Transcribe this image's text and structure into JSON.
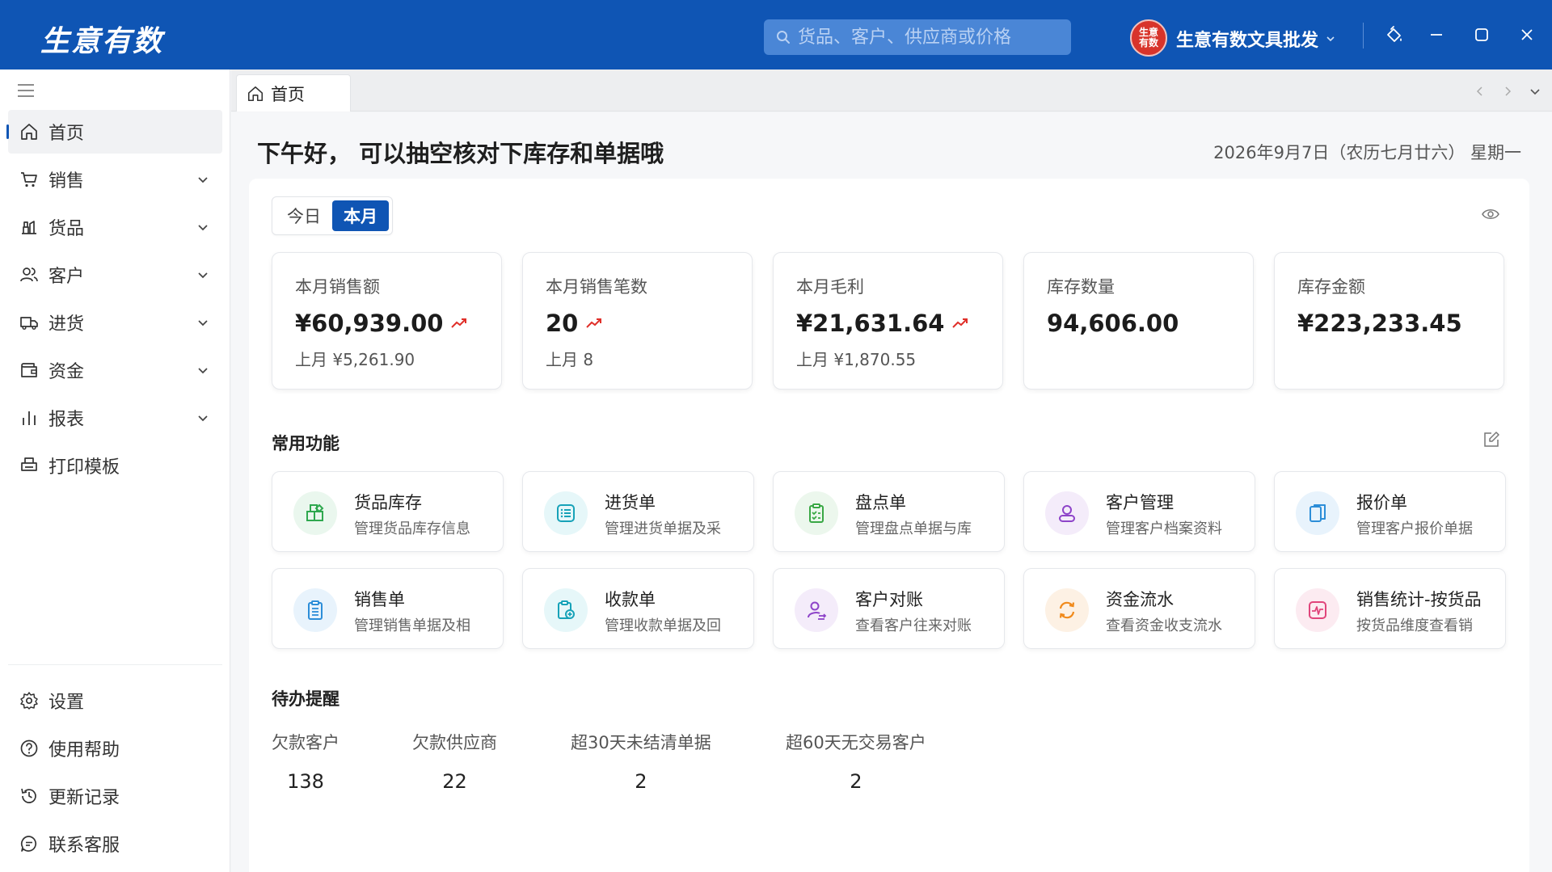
{
  "app": {
    "brand": "生意有数"
  },
  "search": {
    "placeholder": "货品、客户、供应商或价格"
  },
  "store": {
    "logo_text_1": "生意",
    "logo_text_2": "有数",
    "name": "生意有数文具批发"
  },
  "tab": {
    "label": "首页"
  },
  "sidebar": {
    "items": [
      {
        "label": "首页",
        "icon": "home-icon"
      },
      {
        "label": "销售",
        "icon": "cart-icon"
      },
      {
        "label": "货品",
        "icon": "goods-icon"
      },
      {
        "label": "客户",
        "icon": "customers-icon"
      },
      {
        "label": "进货",
        "icon": "truck-icon"
      },
      {
        "label": "资金",
        "icon": "wallet-icon"
      },
      {
        "label": "报表",
        "icon": "bar-chart-icon"
      },
      {
        "label": "打印模板",
        "icon": "printer-icon"
      }
    ],
    "bottom": [
      {
        "label": "设置",
        "icon": "gear-icon"
      },
      {
        "label": "使用帮助",
        "icon": "help-icon"
      },
      {
        "label": "更新记录",
        "icon": "history-icon"
      },
      {
        "label": "联系客服",
        "icon": "chat-icon"
      }
    ]
  },
  "main": {
    "greeting": "下午好，  可以抽空核对下库存和单据哦",
    "date": "2026年9月7日（农历七月廿六） 星期一",
    "period_tabs": [
      "今日",
      "本月"
    ],
    "active_period": "本月"
  },
  "stats": [
    {
      "label": "本月销售额",
      "value": "¥60,939.00",
      "trend": "up",
      "prev": "上月 ¥5,261.90"
    },
    {
      "label": "本月销售笔数",
      "value": "20",
      "trend": "up",
      "prev": "上月 8"
    },
    {
      "label": "本月毛利",
      "value": "¥21,631.64",
      "trend": "up",
      "prev": "上月 ¥1,870.55"
    },
    {
      "label": "库存数量",
      "value": "94,606.00"
    },
    {
      "label": "库存金额",
      "value": "¥223,233.45"
    }
  ],
  "functions": {
    "title": "常用功能",
    "items": [
      {
        "name": "货品库存",
        "desc": "管理货品库存信息",
        "icon": "inventory-icon",
        "color": "#2fa84f",
        "bg": "#eaf7ee"
      },
      {
        "name": "进货单",
        "desc": "管理进货单据及采",
        "icon": "purchase-list-icon",
        "color": "#17a2b8",
        "bg": "#e6f7f9"
      },
      {
        "name": "盘点单",
        "desc": "管理盘点单据与库",
        "icon": "stocktake-icon",
        "color": "#3aa845",
        "bg": "#ecf7ed"
      },
      {
        "name": "客户管理",
        "desc": "管理客户档案资料",
        "icon": "customer-icon",
        "color": "#8e44c9",
        "bg": "#f4ecfa"
      },
      {
        "name": "报价单",
        "desc": "管理客户报价单据",
        "icon": "quote-icon",
        "color": "#2d8ed8",
        "bg": "#e8f3fc"
      },
      {
        "name": "销售单",
        "desc": "管理销售单据及相",
        "icon": "sales-order-icon",
        "color": "#2d8ed8",
        "bg": "#e8f3fc"
      },
      {
        "name": "收款单",
        "desc": "管理收款单据及回",
        "icon": "receipt-icon",
        "color": "#17a2b8",
        "bg": "#e6f7f9"
      },
      {
        "name": "客户对账",
        "desc": "查看客户往来对账",
        "icon": "reconcile-icon",
        "color": "#8e44c9",
        "bg": "#f4ecfa"
      },
      {
        "name": "资金流水",
        "desc": "查看资金收支流水",
        "icon": "cashflow-icon",
        "color": "#f08a1c",
        "bg": "#fdf1e4"
      },
      {
        "name": "销售统计-按货品",
        "desc": "按货品维度查看销",
        "icon": "sales-stats-icon",
        "color": "#e0457b",
        "bg": "#fcebf1"
      }
    ]
  },
  "todo": {
    "title": "待办提醒",
    "items": [
      {
        "label": "欠款客户",
        "value": "138"
      },
      {
        "label": "欠款供应商",
        "value": "22"
      },
      {
        "label": "超30天未结清单据",
        "value": "2"
      },
      {
        "label": "超60天无交易客户",
        "value": "2"
      }
    ]
  },
  "colors": {
    "brand": "#0f55b4",
    "trend_up": "#e0302a"
  }
}
